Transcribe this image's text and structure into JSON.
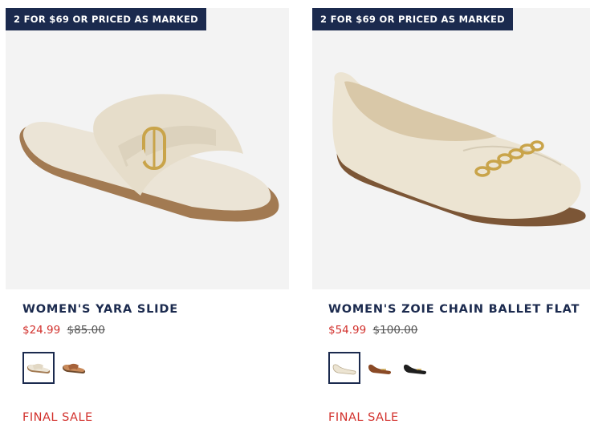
{
  "products": [
    {
      "badge": "2 FOR $69 OR PRICED AS MARKED",
      "name": "WOMEN'S YARA SLIDE",
      "sale_price": "$24.99",
      "original_price": "$85.00",
      "swatches": [
        "cream",
        "tan"
      ],
      "final_sale_label": "FINAL SALE"
    },
    {
      "badge": "2 FOR $69 OR PRICED AS MARKED",
      "name": "WOMEN'S ZOIE CHAIN BALLET FLAT",
      "sale_price": "$54.99",
      "original_price": "$100.00",
      "swatches": [
        "cream",
        "brown",
        "black"
      ],
      "final_sale_label": "FINAL SALE"
    }
  ],
  "colors": {
    "navy": "#1b2a4e",
    "sale_red": "#d2312d",
    "image_bg": "#f3f3f3"
  }
}
